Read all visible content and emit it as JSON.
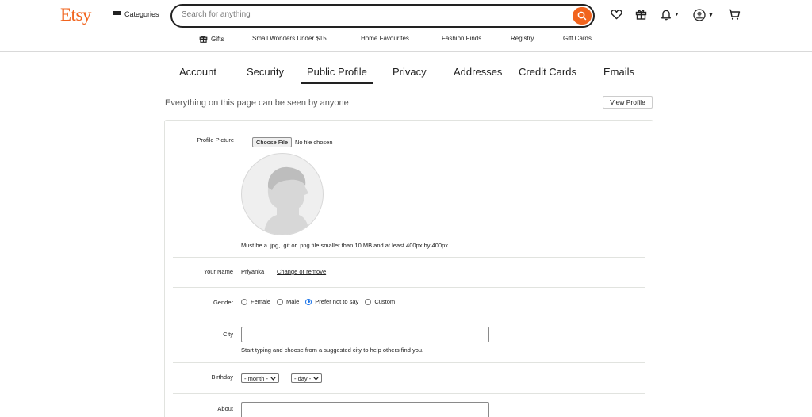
{
  "header": {
    "logo": "Etsy",
    "categories_label": "Categories",
    "search_placeholder": "Search for anything",
    "accent": "#f1641e"
  },
  "subnav": {
    "items": [
      "Gifts",
      "Small Wonders Under $15",
      "Home Favourites",
      "Fashion Finds",
      "Registry",
      "Gift Cards"
    ]
  },
  "tabs": [
    "Account",
    "Security",
    "Public Profile",
    "Privacy",
    "Addresses",
    "Credit Cards",
    "Emails"
  ],
  "active_tab": "Public Profile",
  "notice": "Everything on this page can be seen by anyone",
  "view_profile_label": "View Profile",
  "form": {
    "profile_picture": {
      "label": "Profile Picture",
      "choose_file_label": "Choose File",
      "no_file_text": "No file chosen",
      "hint": "Must be a .jpg, .gif or .png file smaller than 10 MB and at least 400px by 400px."
    },
    "your_name": {
      "label": "Your Name",
      "value": "Priyanka",
      "change_link": "Change or remove"
    },
    "gender": {
      "label": "Gender",
      "options": [
        "Female",
        "Male",
        "Prefer not to say",
        "Custom"
      ],
      "selected": "Prefer not to say"
    },
    "city": {
      "label": "City",
      "value": "",
      "hint": "Start typing and choose from a suggested city to help others find you."
    },
    "birthday": {
      "label": "Birthday",
      "month_value": "- month -",
      "day_value": "- day -"
    },
    "about": {
      "label": "About",
      "value": ""
    }
  }
}
